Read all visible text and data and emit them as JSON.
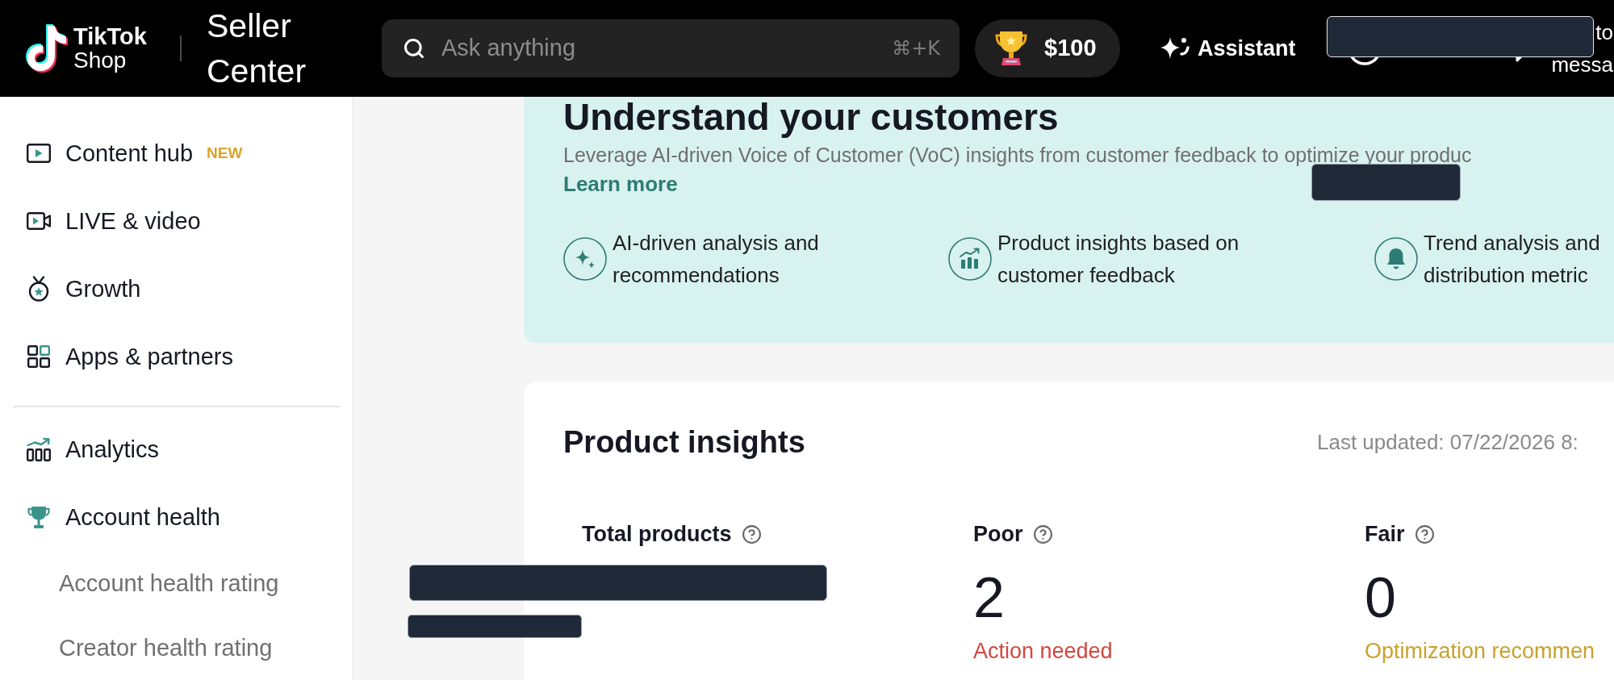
{
  "header": {
    "logo": [
      "TikTok",
      "Shop"
    ],
    "app_title": "Seller Center",
    "search": {
      "placeholder": "Ask anything",
      "shortcut": "⌘+K"
    },
    "reward": {
      "amount": "$100"
    },
    "assistant": {
      "label": "Assistant"
    },
    "nav_label": [
      "to",
      "messa"
    ]
  },
  "sidebar": {
    "sections": [
      {
        "items": [
          {
            "label": "Content hub",
            "badge": "NEW"
          },
          {
            "label": "LIVE & video"
          },
          {
            "label": "Growth"
          },
          {
            "label": "Apps & partners"
          }
        ]
      },
      {
        "items": [
          {
            "label": "Analytics"
          },
          {
            "label": "Account health",
            "children": [
              {
                "label": "Account health rating"
              },
              {
                "label": "Creator health rating"
              }
            ]
          }
        ]
      }
    ]
  },
  "banner": {
    "title": "Understand your customers",
    "description": "Leverage AI-driven Voice of Customer (VoC) insights from customer feedback to optimize your produc",
    "link": "Learn more",
    "features": [
      {
        "text": "AI-driven analysis and recommendations"
      },
      {
        "text": "Product insights based on customer feedback"
      },
      {
        "text": "Trend analysis and distribution metric"
      }
    ]
  },
  "insights": {
    "title": "Product insights",
    "last_updated": "Last updated: 07/22/2026 8:",
    "metrics": [
      {
        "label": "Total products"
      },
      {
        "label": "Poor",
        "value": "2",
        "status": "Action needed",
        "color": "#d5463c"
      },
      {
        "label": "Fair",
        "value": "0",
        "status": "Optimization recommen",
        "color": "#c9a12c"
      }
    ]
  }
}
